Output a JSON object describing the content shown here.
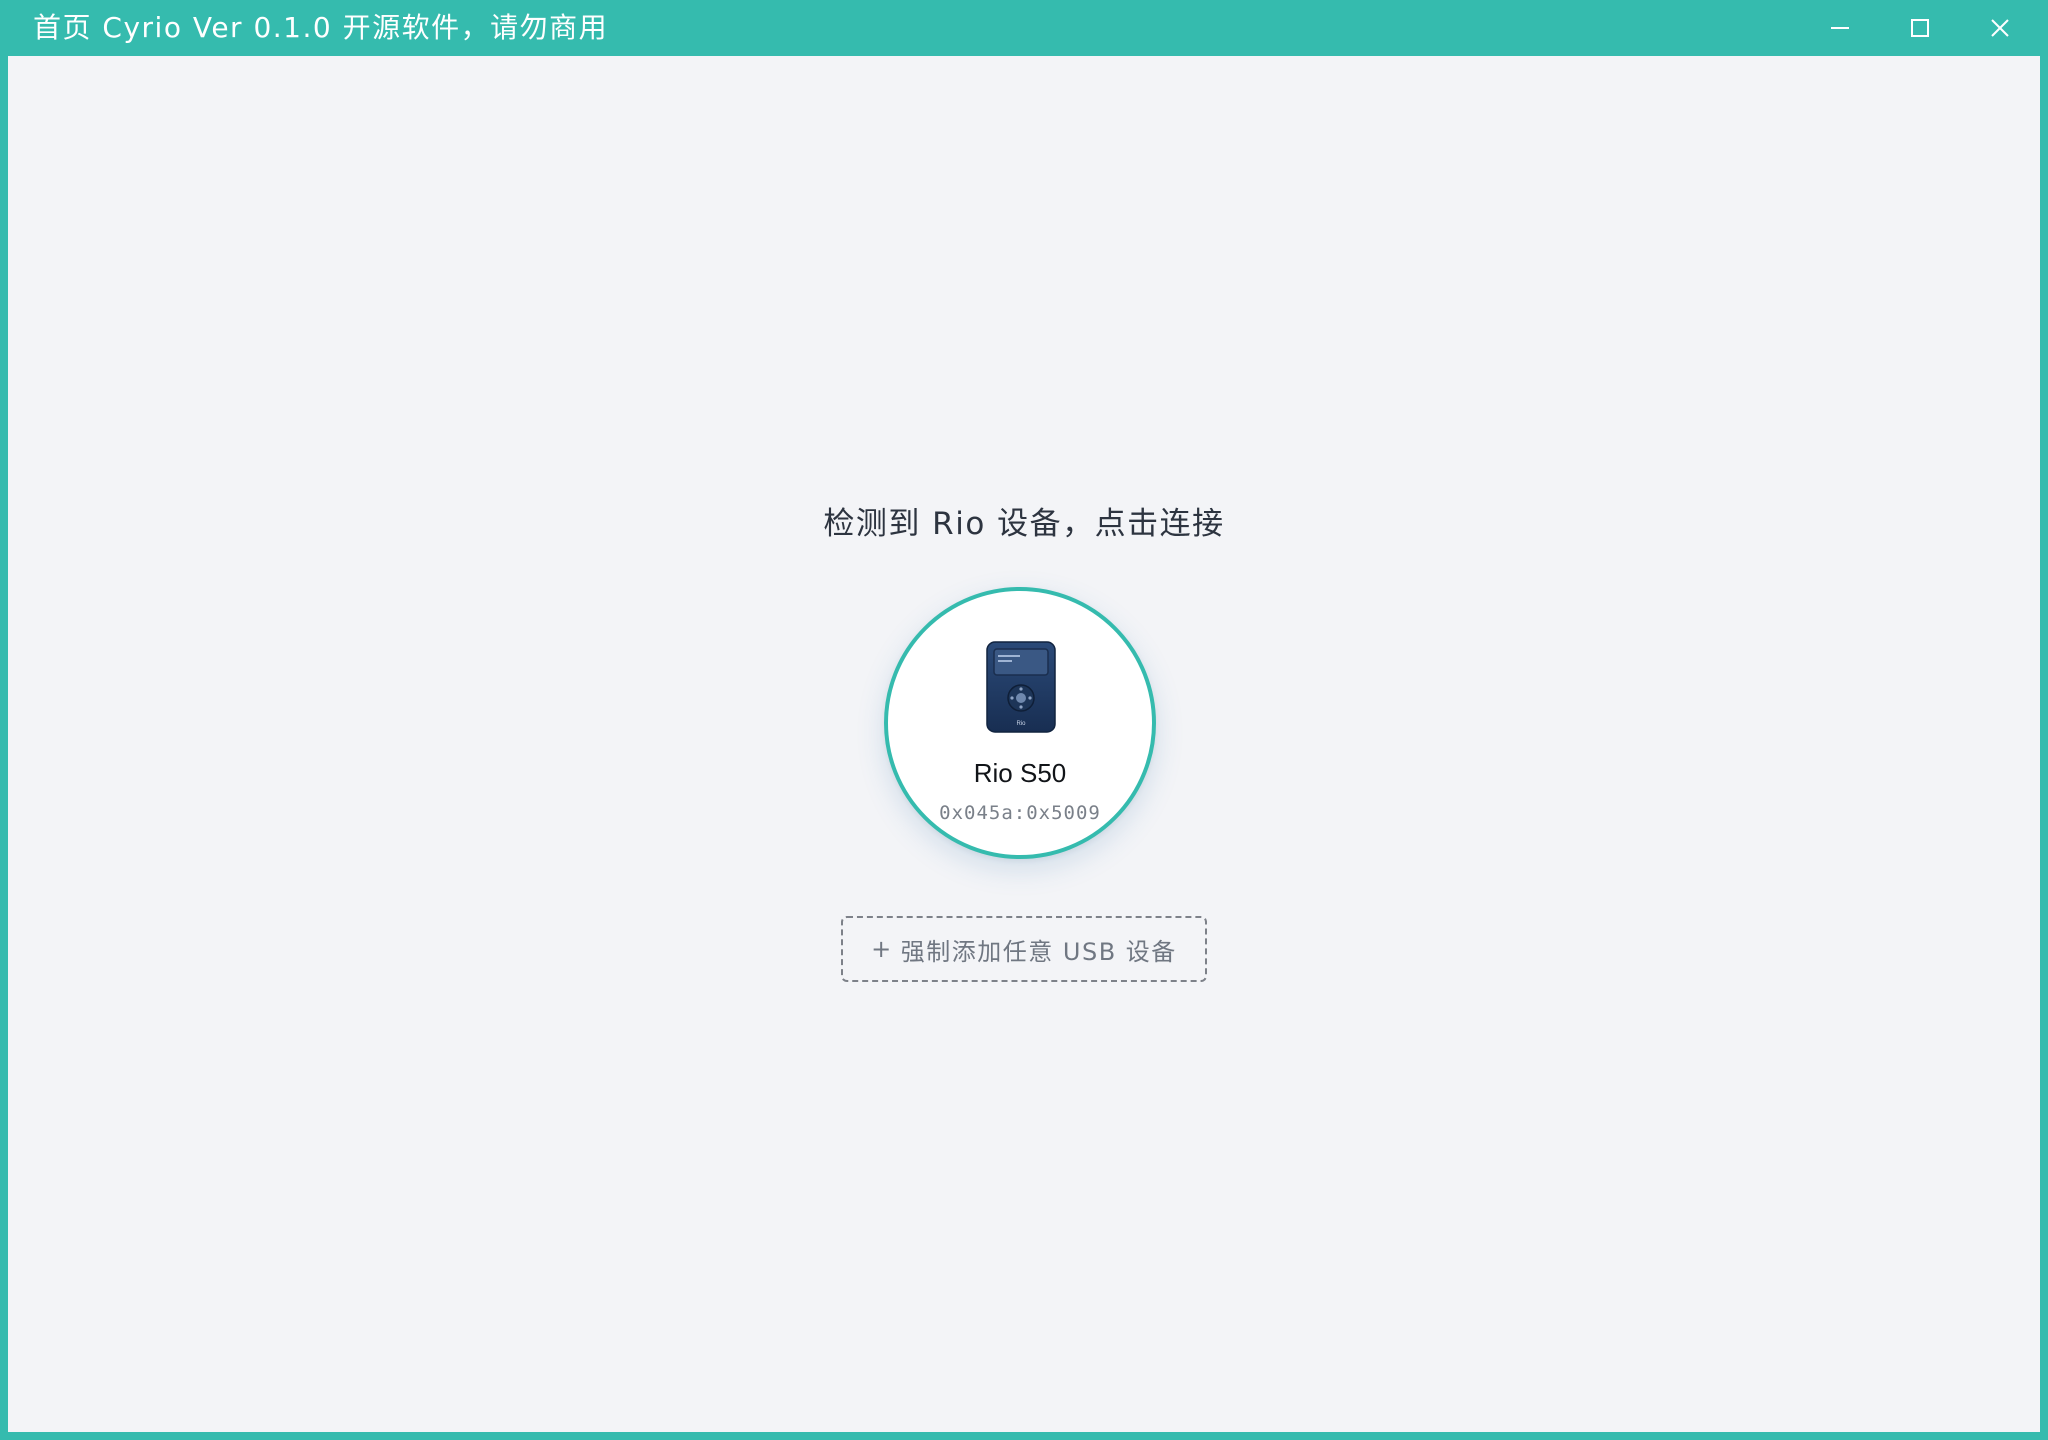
{
  "window": {
    "title": "首页 Cyrio Ver 0.1.0 开源软件，请勿商用",
    "accent_color": "#35BBAE",
    "controls": {
      "minimize_icon": "minimize-icon",
      "maximize_icon": "maximize-icon",
      "close_icon": "close-icon"
    }
  },
  "main": {
    "prompt": "检测到 Rio 设备，点击连接",
    "device": {
      "icon": "mp3-player-icon",
      "icon_brand_text": "Rio",
      "name": "Rio S50",
      "usb_id": "0x045a:0x5009"
    },
    "force_add": {
      "icon": "+",
      "label": "强制添加任意 USB 设备"
    }
  }
}
